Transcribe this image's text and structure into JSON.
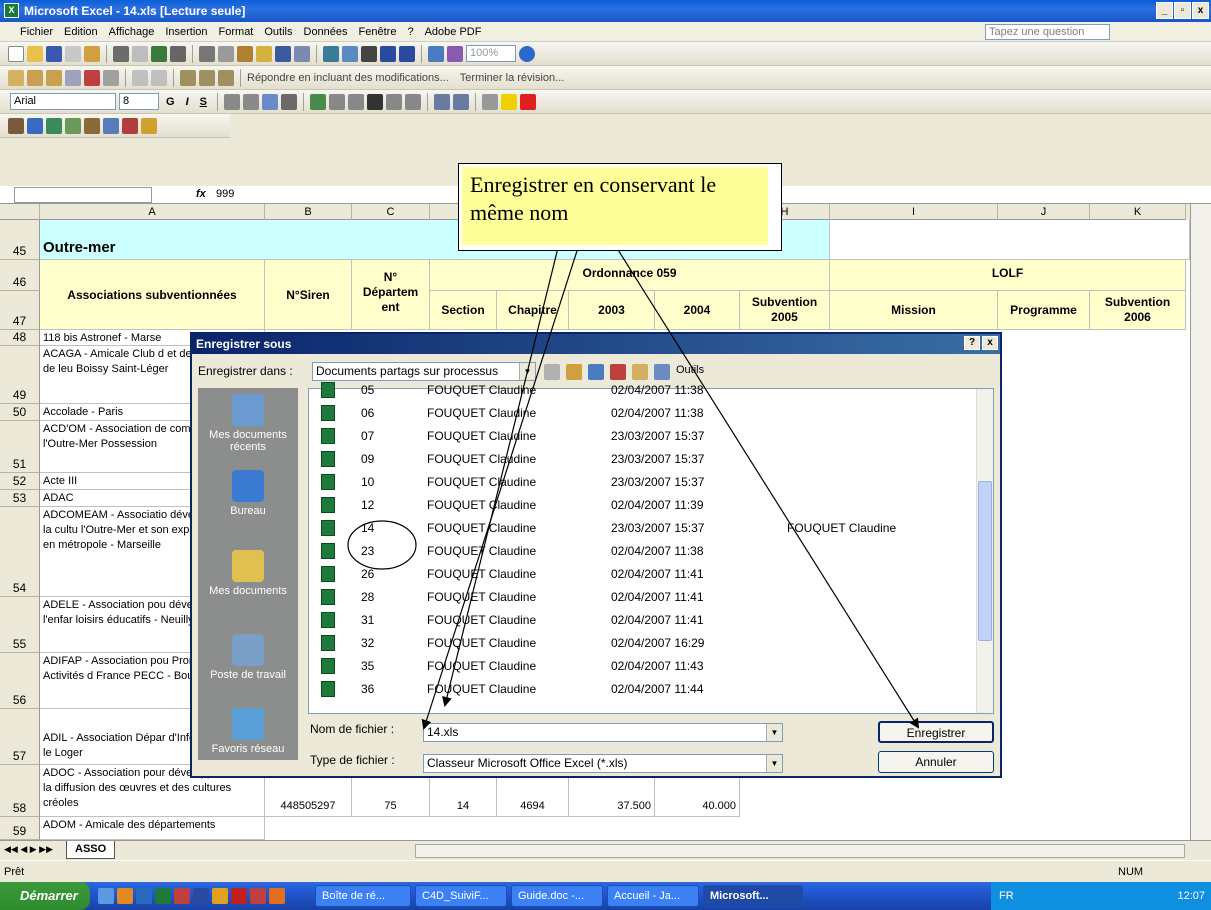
{
  "window": {
    "title": "Microsoft Excel - 14.xls  [Lecture seule]",
    "btn_min": "_",
    "btn_max": "▫",
    "btn_close": "x"
  },
  "menu": {
    "items": [
      "Fichier",
      "Edition",
      "Affichage",
      "Insertion",
      "Format",
      "Outils",
      "Données",
      "Fenêtre",
      "?",
      "Adobe PDF"
    ],
    "question_placeholder": "Tapez une question"
  },
  "toolbar": {
    "zoom": "100%",
    "review_text": "Répondre en incluant des modifications...",
    "end_review": "Terminer la révision...",
    "font": "Arial",
    "size": "8",
    "bold": "G",
    "italic": "I",
    "underline": "S"
  },
  "formula": {
    "fx": "fx",
    "value": "999"
  },
  "columns": [
    "A",
    "B",
    "C",
    "",
    "",
    "",
    "",
    "H",
    "I",
    "J",
    "K"
  ],
  "sheet": {
    "row45": {
      "num": "45",
      "title": "Outre-mer"
    },
    "row46": {
      "num": "46",
      "a": "Associations subventionnées",
      "b": "N°Siren",
      "c": "N° Départem ent",
      "ordonnance": "Ordonnance 059",
      "lolf": "LOLF"
    },
    "row47": {
      "num": "47",
      "section": "Section",
      "chapitre": "Chapitre",
      "y2003": "2003",
      "y2004": "2004",
      "sub2005": "Subvention 2005",
      "mission": "Mission",
      "programme": "Programme",
      "sub2006": "Subvention 2006"
    },
    "rows": [
      {
        "num": "48",
        "a": "118 bis Astronef - Marse"
      },
      {
        "num": "49",
        "a": "ACAGA - Amicale Club d et des Guyanais et de leu Boissy Saint-Léger"
      },
      {
        "num": "50",
        "a": "Accolade - Paris"
      },
      {
        "num": "51",
        "a": "ACD'OM - Association de communes de l'Outre-Mer Possession"
      },
      {
        "num": "52",
        "a": "Acte III"
      },
      {
        "num": "53",
        "a": "ADAC"
      },
      {
        "num": "54",
        "a": "ADCOMEAM - Associatio développement de la cultu l'Outre-Mer et son expres artistique en métropole - Marseille"
      },
      {
        "num": "55",
        "a": "ADELE - Association pou développement de l'enfar loisirs éducatifs - Neuilly"
      },
      {
        "num": "56",
        "a": "ADIFAP - Association pou Promotion des Activités d France PECC - Boulogne-"
      },
      {
        "num": "57",
        "a": "ADIL - Association Dépar d'Information sur le Loger"
      },
      {
        "num": "58",
        "a": "ADOC - Association pour développement et la diffusion des œuvres et des cultures créoles",
        "b": "448505297",
        "c": "75",
        "d": "14",
        "e": "4694",
        "f": "37.500",
        "g": "40.000"
      },
      {
        "num": "59",
        "a": "ADOM - Amicale des départements"
      }
    ]
  },
  "sheettab": "ASSO",
  "status": {
    "left": "Prêt",
    "num": "NUM"
  },
  "dialog": {
    "title": "Enregistrer sous",
    "help": "?",
    "close": "x",
    "save_in_label": "Enregistrer dans :",
    "save_in_value": "Documents partags sur processus",
    "tools": "Outils",
    "places": [
      "Mes documents récents",
      "Bureau",
      "Mes documents",
      "Poste de travail",
      "Favoris réseau"
    ],
    "files": [
      {
        "name": "05",
        "owner": "FOUQUET Claudine",
        "date": "02/04/2007 11:38"
      },
      {
        "name": "06",
        "owner": "FOUQUET Claudine",
        "date": "02/04/2007 11:38"
      },
      {
        "name": "07",
        "owner": "FOUQUET Claudine",
        "date": "23/03/2007 15:37"
      },
      {
        "name": "09",
        "owner": "FOUQUET Claudine",
        "date": "23/03/2007 15:37"
      },
      {
        "name": "10",
        "owner": "FOUQUET Claudine",
        "date": "23/03/2007 15:37"
      },
      {
        "name": "12",
        "owner": "FOUQUET Claudine",
        "date": "02/04/2007 11:39"
      },
      {
        "name": "14",
        "owner": "FOUQUET Claudine",
        "date": "23/03/2007 15:37",
        "extra": "FOUQUET Claudine"
      },
      {
        "name": "23",
        "owner": "FOUQUET Claudine",
        "date": "02/04/2007 11:38"
      },
      {
        "name": "26",
        "owner": "FOUQUET Claudine",
        "date": "02/04/2007 11:41"
      },
      {
        "name": "28",
        "owner": "FOUQUET Claudine",
        "date": "02/04/2007 11:41"
      },
      {
        "name": "31",
        "owner": "FOUQUET Claudine",
        "date": "02/04/2007 11:41"
      },
      {
        "name": "32",
        "owner": "FOUQUET Claudine",
        "date": "02/04/2007 16:29"
      },
      {
        "name": "35",
        "owner": "FOUQUET Claudine",
        "date": "02/04/2007 11:43"
      },
      {
        "name": "36",
        "owner": "FOUQUET Claudine",
        "date": "02/04/2007 11:44"
      }
    ],
    "filename_label": "Nom de fichier :",
    "filename_value": "14.xls",
    "filetype_label": "Type de fichier :",
    "filetype_value": "Classeur Microsoft Office Excel (*.xls)",
    "save_button": "Enregistrer",
    "cancel_button": "Annuler"
  },
  "callout": {
    "text": "Enregistrer en conservant le même nom"
  },
  "taskbar": {
    "start": "Démarrer",
    "tasks": [
      "Boîte de ré...",
      "C4D_SuiviF...",
      "Guide.doc -...",
      "Accueil - Ja...",
      "Microsoft..."
    ],
    "lang": "FR",
    "clock": "12:07"
  }
}
